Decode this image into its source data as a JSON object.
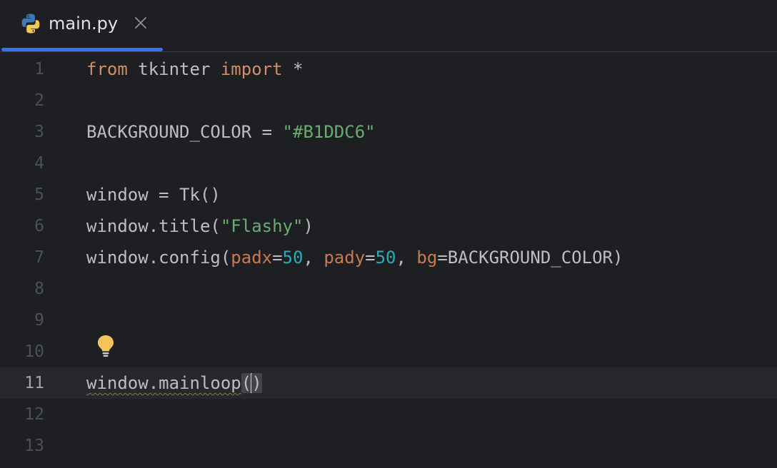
{
  "tab": {
    "label": "main.py",
    "icon": "python-file-icon",
    "close_icon": "close-icon"
  },
  "colors": {
    "accent": "#3574f0",
    "keyword": "#cf8e6d",
    "string": "#6aab73",
    "number": "#2aacb8",
    "parameter": "#c77a52",
    "text": "#bcbec4",
    "background": "#1e1f22",
    "current_line": "#26282e"
  },
  "editor": {
    "line_numbers": [
      "1",
      "2",
      "3",
      "4",
      "5",
      "6",
      "7",
      "8",
      "9",
      "10",
      "11",
      "12",
      "13"
    ],
    "current_line": "11",
    "intention_icon": "lightbulb-icon",
    "code": {
      "l1": {
        "kw_from": "from",
        "module": " tkinter ",
        "kw_import": "import",
        "rest": " *"
      },
      "l3": {
        "name": "BACKGROUND_COLOR = ",
        "value": "\"#B1DDC6\""
      },
      "l5": {
        "text": "window = Tk()"
      },
      "l6": {
        "call": "window.title(",
        "arg": "\"Flashy\"",
        "close": ")"
      },
      "l7": {
        "call": "window.config(",
        "p1": "padx",
        "eq1": "=",
        "v1": "50",
        "sep1": ", ",
        "p2": "pady",
        "eq2": "=",
        "v2": "50",
        "sep2": ", ",
        "p3": "bg",
        "eq3": "=BACKGROUND_COLOR",
        "close": ")"
      },
      "l11": {
        "call": "window.mainloop",
        "open": "(",
        "close": ")"
      }
    }
  }
}
